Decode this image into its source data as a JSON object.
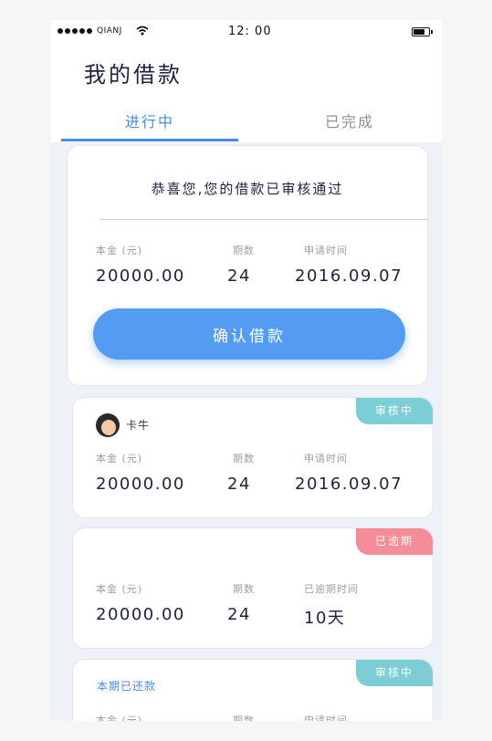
{
  "status_bar": {
    "carrier": "QIANJ",
    "time": "12: 00"
  },
  "header": {
    "title": "我的借款",
    "tabs": [
      {
        "label": "进行中",
        "active": true
      },
      {
        "label": "已完成",
        "active": false
      }
    ]
  },
  "approved_card": {
    "message": "恭喜您,您的借款已审核通过",
    "principal_label": "本金 (元)",
    "periods_label": "期数",
    "date_label": "申请时间",
    "principal": "20000.00",
    "periods": "24",
    "date": "2016.09.07",
    "button_label": "确认借款"
  },
  "loans": [
    {
      "status": "审核中",
      "status_color": "#7ccdd6",
      "user_name": "卡牛",
      "principal_label": "本金 (元)",
      "periods_label": "期数",
      "third_label": "申请时间",
      "principal": "20000.00",
      "periods": "24",
      "third_value": "2016.09.07"
    },
    {
      "status": "已逾期",
      "status_color": "#f48d97",
      "principal_label": "本金 (元)",
      "periods_label": "期数",
      "third_label": "已逾期时间",
      "principal": "20000.00",
      "periods": "24",
      "third_value": "10天"
    },
    {
      "status": "审核中",
      "status_color": "#7ccdd6",
      "note": "本期已还款",
      "principal_label": "本金 (元)",
      "periods_label": "期数",
      "third_label": "申请时间"
    }
  ],
  "colors": {
    "accent": "#4a8ae8",
    "button": "#549cf2",
    "reviewing": "#7ccdd6",
    "overdue": "#f48d97",
    "text_dark": "#1c2340"
  }
}
